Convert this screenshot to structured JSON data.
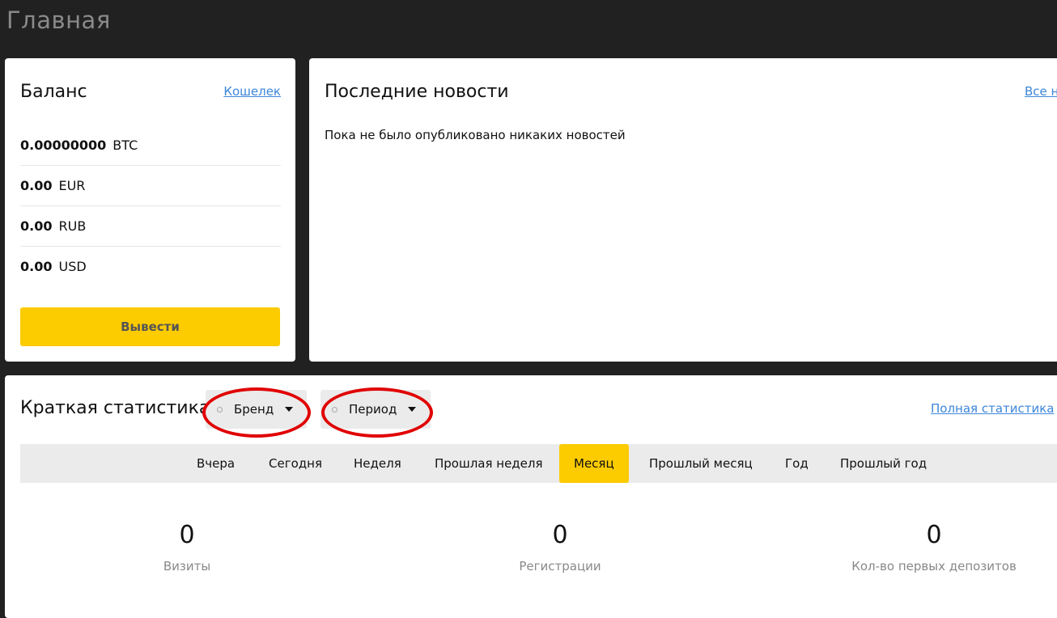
{
  "page": {
    "title": "Главная"
  },
  "balance": {
    "title": "Баланс",
    "wallet_link": "Кошелек",
    "rows": [
      {
        "amount": "0.00000000",
        "currency": "BTC"
      },
      {
        "amount": "0.00",
        "currency": "EUR"
      },
      {
        "amount": "0.00",
        "currency": "RUB"
      },
      {
        "amount": "0.00",
        "currency": "USD"
      }
    ],
    "withdraw_label": "Вывести"
  },
  "news": {
    "title": "Последние новости",
    "all_link": "Все н",
    "empty_text": "Пока не было опубликовано никаких новостей"
  },
  "stats": {
    "title": "Краткая статистика",
    "brand_dropdown": "Бренд",
    "period_dropdown": "Период",
    "full_link": "Полная статистика",
    "tabs": [
      "Вчера",
      "Сегодня",
      "Неделя",
      "Прошлая неделя",
      "Месяц",
      "Прошлый месяц",
      "Год",
      "Прошлый год"
    ],
    "active_tab": "Месяц",
    "metrics": [
      {
        "value": "0",
        "label": "Визиты"
      },
      {
        "value": "0",
        "label": "Регистрации"
      },
      {
        "value": "0",
        "label": "Кол-во первых депозитов"
      }
    ]
  },
  "colors": {
    "accent": "#fccb00",
    "link": "#3d86d8",
    "highlight": "#e00000",
    "background": "#212121"
  },
  "icons": {
    "dropdown_caret": "caret-down-icon",
    "dropdown_dot": "radio-dot-icon"
  }
}
